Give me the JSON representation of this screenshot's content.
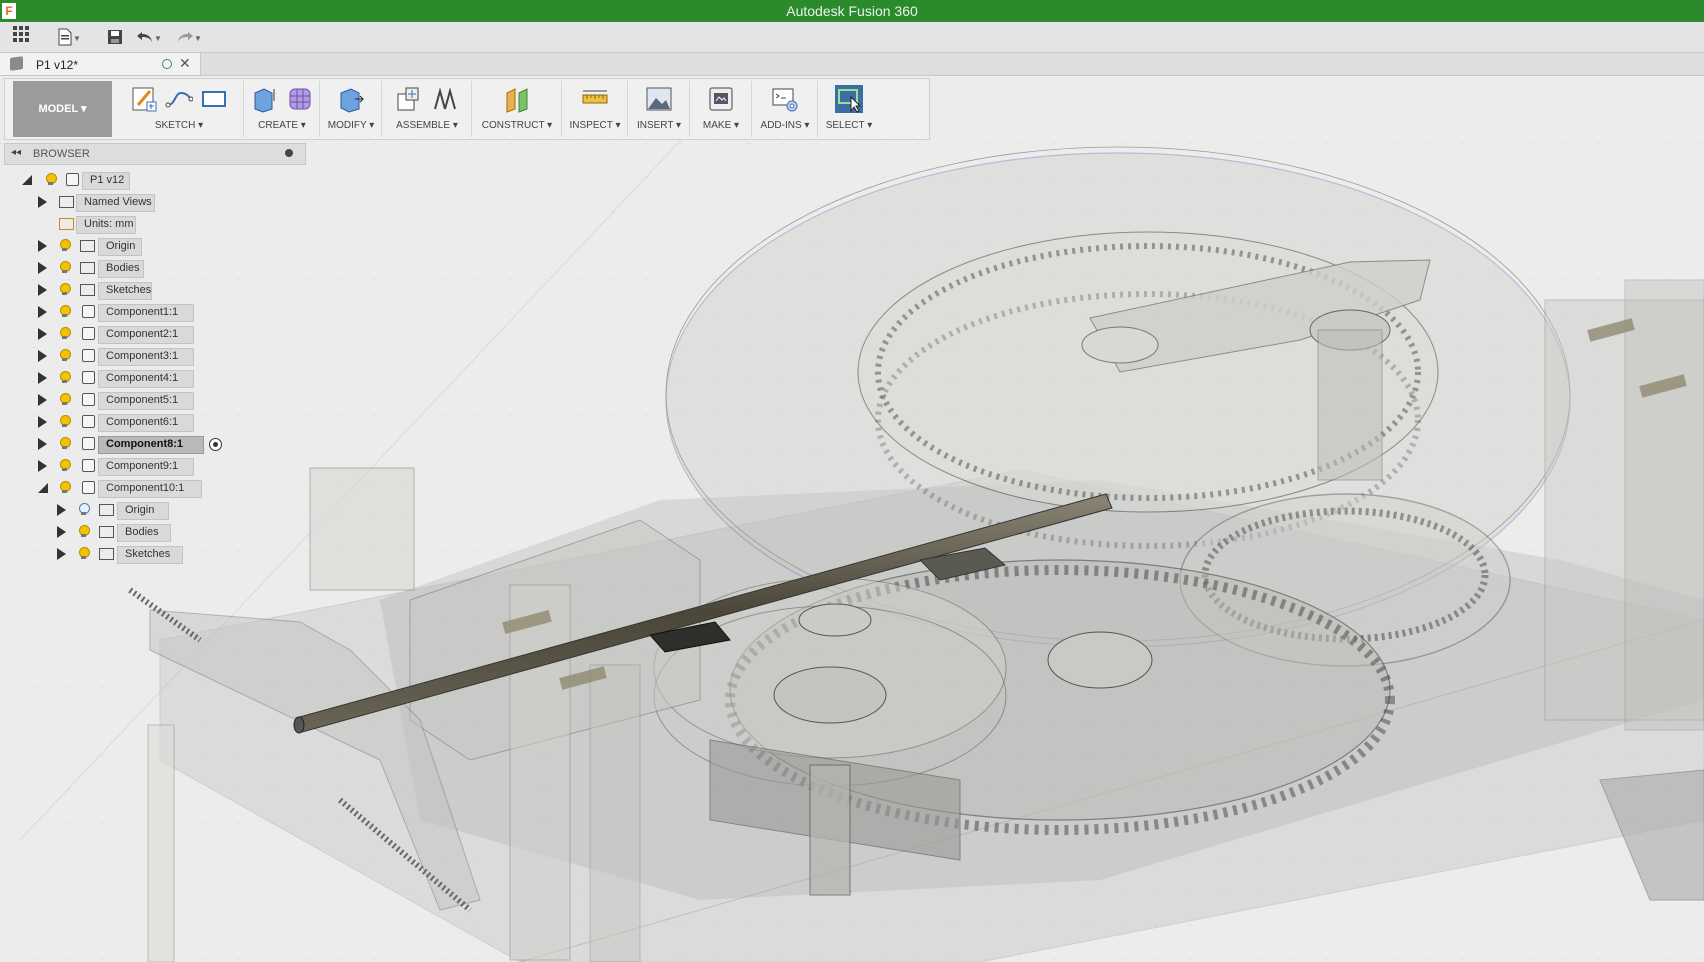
{
  "app": {
    "title": "Autodesk Fusion 360",
    "logo": "F"
  },
  "qat": {
    "icons": [
      "apps-grid-icon",
      "file-menu-icon",
      "save-icon",
      "undo-icon",
      "redo-icon"
    ]
  },
  "document": {
    "tab_label": "P1 v12*"
  },
  "toolbar": {
    "workspace": "MODEL",
    "groups": [
      {
        "label": "SKETCH"
      },
      {
        "label": "CREATE"
      },
      {
        "label": "MODIFY"
      },
      {
        "label": "ASSEMBLE"
      },
      {
        "label": "CONSTRUCT"
      },
      {
        "label": "INSPECT"
      },
      {
        "label": "INSERT"
      },
      {
        "label": "MAKE"
      },
      {
        "label": "ADD-INS"
      },
      {
        "label": "SELECT"
      }
    ]
  },
  "browser": {
    "title": "BROWSER",
    "nodes": [
      {
        "label": "P1 v12"
      },
      {
        "label": "Named Views"
      },
      {
        "label": "Units: mm"
      },
      {
        "label": "Origin"
      },
      {
        "label": "Bodies"
      },
      {
        "label": "Sketches"
      },
      {
        "label": "Component1:1"
      },
      {
        "label": "Component2:1"
      },
      {
        "label": "Component3:1"
      },
      {
        "label": "Component4:1"
      },
      {
        "label": "Component5:1"
      },
      {
        "label": "Component6:1"
      },
      {
        "label": "Component8:1"
      },
      {
        "label": "Component9:1"
      },
      {
        "label": "Component10:1"
      },
      {
        "label": "Origin"
      },
      {
        "label": "Bodies"
      },
      {
        "label": "Sketches"
      }
    ]
  },
  "colors": {
    "title_bar": "#2b8a2b",
    "accent_select": "#3a6ea5",
    "bulb": "#f4c200"
  }
}
